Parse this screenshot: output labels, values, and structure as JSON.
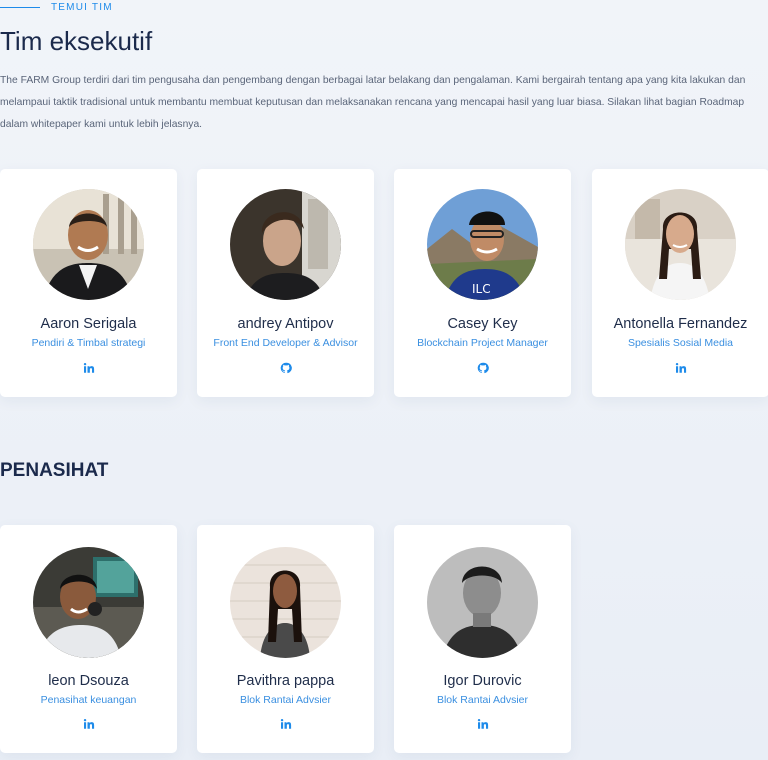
{
  "section": {
    "eyebrow": "TEMUI TIM",
    "title": "Tim eksekutif",
    "intro": "The FARM Group terdiri dari tim pengusaha dan pengembang dengan berbagai latar belakang dan pengalaman. Kami bergairah tentang apa yang kita lakukan dan melampaui taktik tradisional untuk membantu membuat keputusan dan melaksanakan rencana yang mencapai hasil yang luar biasa. Silakan lihat bagian Roadmap dalam whitepaper kami untuk lebih jelasnya."
  },
  "executives": [
    {
      "name": "Aaron Serigala",
      "role": "Pendiri & Timbal strategi",
      "social": "linkedin-icon"
    },
    {
      "name": "andrey Antipov",
      "role": "Front End Developer & Advisor",
      "social": "github-icon"
    },
    {
      "name": "Casey Key",
      "role": "Blockchain Project Manager",
      "social": "github-icon"
    },
    {
      "name": "Antonella Fernandez",
      "role": "Spesialis Sosial Media",
      "social": "linkedin-icon"
    }
  ],
  "advisors_heading": "PENASIHAT",
  "advisors": [
    {
      "name": "leon Dsouza",
      "role": "Penasihat keuangan",
      "social": "linkedin-icon"
    },
    {
      "name": "Pavithra pappa",
      "role": "Blok Rantai Advsier",
      "social": "linkedin-icon"
    },
    {
      "name": "Igor Durovic",
      "role": "Blok Rantai Advsier",
      "social": "linkedin-icon"
    }
  ],
  "colors": {
    "accent": "#1e8bea",
    "title": "#1b2a4c",
    "role": "#3a8fe0"
  }
}
